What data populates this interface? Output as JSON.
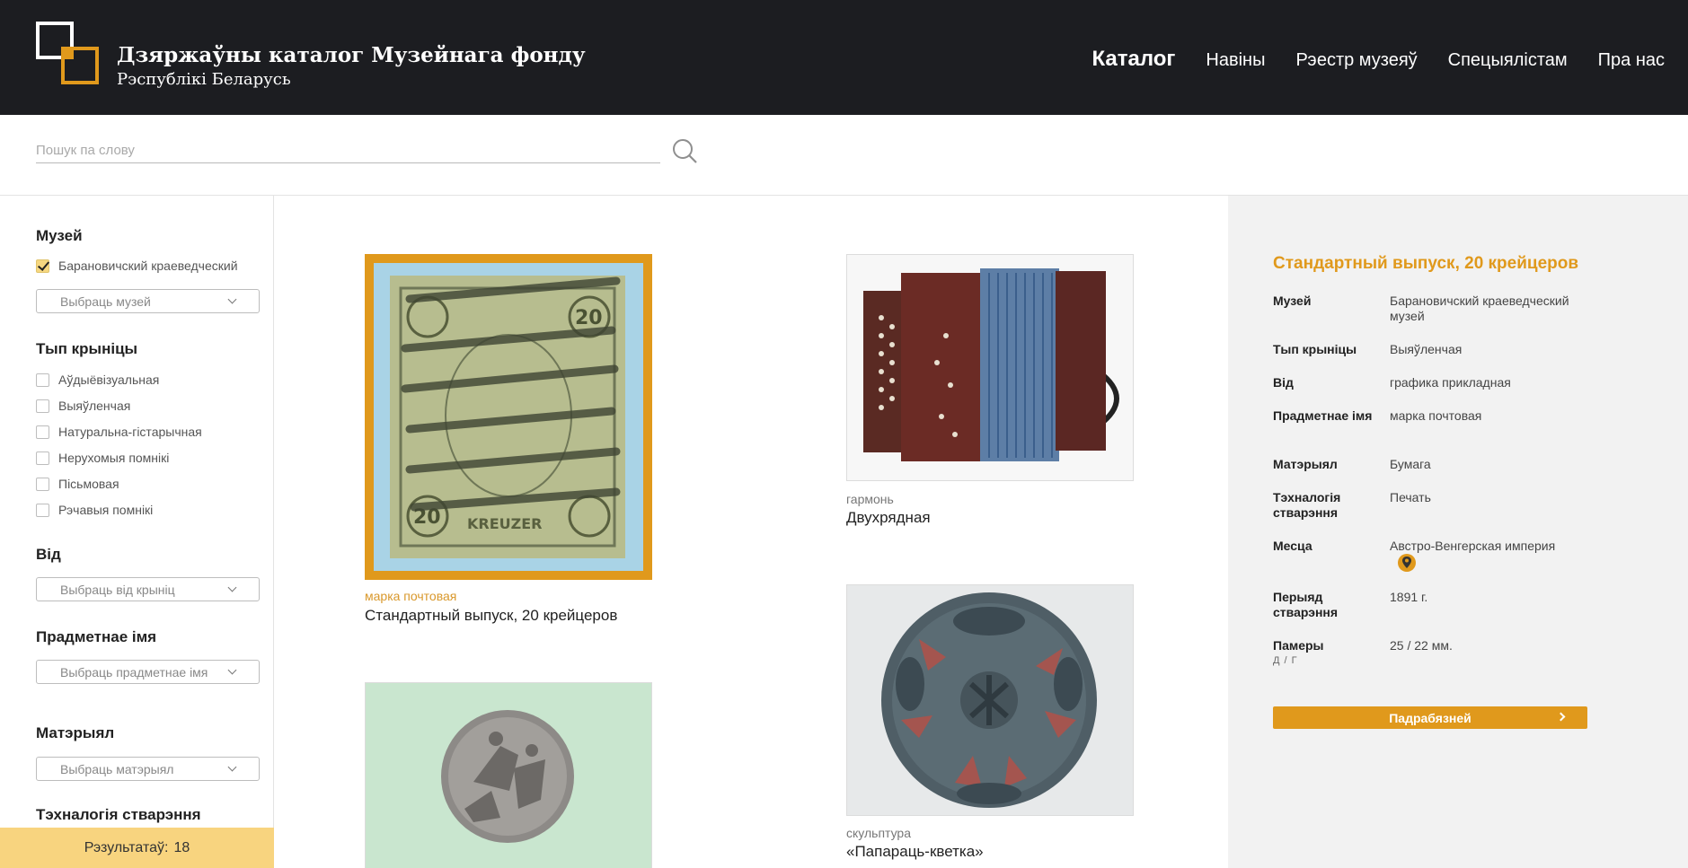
{
  "header": {
    "title": "Дзяржаўны каталог Музейнага фонду",
    "subtitle": "Рэспублікі Беларусь",
    "nav": [
      "Каталог",
      "Навіны",
      "Рэестр музеяў",
      "Спецыялістам",
      "Пра нас"
    ]
  },
  "search": {
    "placeholder": "Пошук па слову",
    "icon": "search-icon"
  },
  "filters": {
    "museum": {
      "title": "Музей",
      "checked_item": "Барановичский краеведческий",
      "select": "Выбраць музей"
    },
    "source": {
      "title": "Тып крыніцы",
      "options": [
        "Аўдыёвізуальная",
        "Выяўленчая",
        "Натуральна-гістарычная",
        "Нерухомыя помнікі",
        "Пісьмовая",
        "Рэчавыя помнікі"
      ]
    },
    "kind": {
      "title": "Від",
      "select": "Выбраць від крыніц"
    },
    "subject": {
      "title": "Прадметнае імя",
      "select": "Выбраць прадметнае імя"
    },
    "material": {
      "title": "Матэрыял",
      "select": "Выбраць матэрыял"
    },
    "technology": {
      "title": "Тэхналогія стварэння"
    }
  },
  "results": {
    "label": "Рэзультатаў:",
    "count": "18"
  },
  "cards": [
    {
      "type": "марка почтовая",
      "title": "Стандартный выпуск, 20 крейцеров"
    },
    {
      "type": "гармонь",
      "title": "Двухрядная"
    },
    {
      "type": "скульптура",
      "title": "«Папараць-кветка»"
    }
  ],
  "detail": {
    "title": "Стандартный выпуск, 20 крейцеров",
    "rows": [
      {
        "label": "Музей",
        "value": "Барановичский краеведческий музей"
      },
      {
        "label": "Тып крыніцы",
        "value": "Выяўленчая"
      },
      {
        "label": "Від",
        "value": "графика прикладная"
      },
      {
        "label": "Прадметнае імя",
        "value": "марка почтовая"
      },
      {
        "label": "Матэрыял",
        "value": "Бумага"
      },
      {
        "label": "Тэхналогія стварэння",
        "value": "Печать"
      },
      {
        "label": "Месца",
        "value": "Австро-Венгерская империя"
      },
      {
        "label": "Перыяд стварэння",
        "value": "1891 г."
      },
      {
        "label": "Памеры",
        "sub": "Д / Г",
        "value": "25 / 22 мм."
      }
    ],
    "button": "Падрабязней"
  },
  "colors": {
    "accent": "#e0991c",
    "header_bg": "#1c1d21",
    "results_bg": "#f8d47f",
    "panel_bg": "#f2f2f2"
  }
}
